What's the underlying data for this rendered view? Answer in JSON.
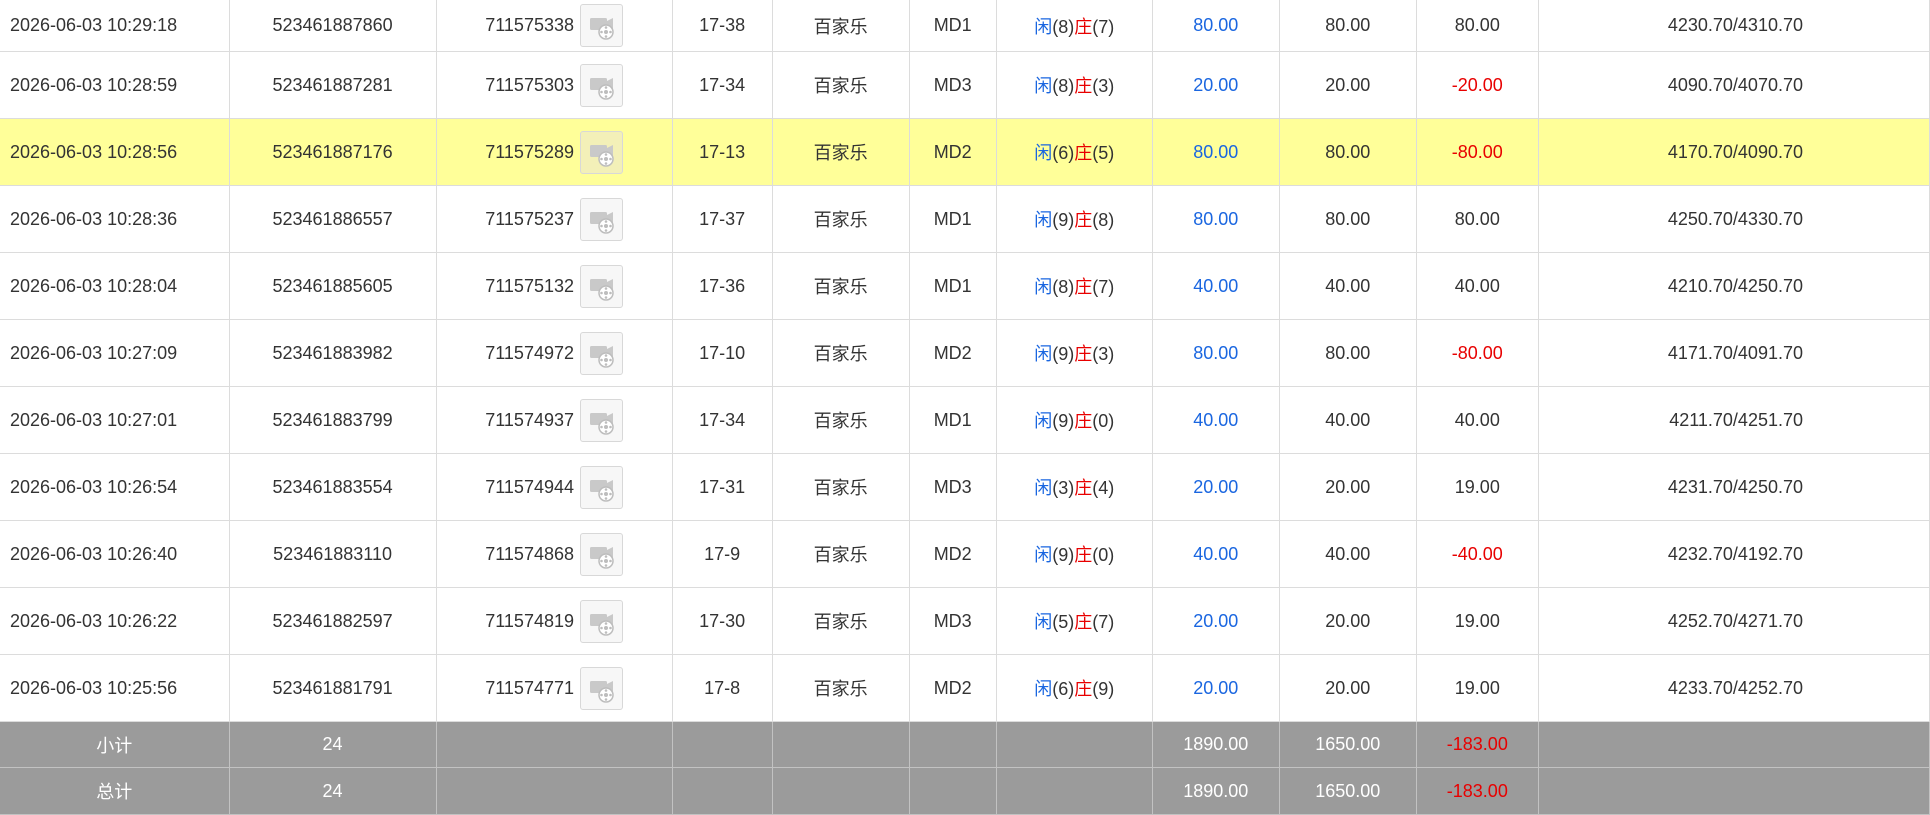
{
  "rows": [
    {
      "time": "2026-06-03 10:29:18",
      "order_id": "523461887860",
      "bet_id": "711575338",
      "table": "17-38",
      "game": "百家乐",
      "room": "MD1",
      "player_label": "闲",
      "player_score": "(8)",
      "banker_label": "庄",
      "banker_score": "(7)",
      "bet": "80.00",
      "valid": "80.00",
      "win": "80.00",
      "win_negative": false,
      "balance": "4230.70/4310.70",
      "highlighted": false
    },
    {
      "time": "2026-06-03 10:28:59",
      "order_id": "523461887281",
      "bet_id": "711575303",
      "table": "17-34",
      "game": "百家乐",
      "room": "MD3",
      "player_label": "闲",
      "player_score": "(8)",
      "banker_label": "庄",
      "banker_score": "(3)",
      "bet": "20.00",
      "valid": "20.00",
      "win": "-20.00",
      "win_negative": true,
      "balance": "4090.70/4070.70",
      "highlighted": false
    },
    {
      "time": "2026-06-03 10:28:56",
      "order_id": "523461887176",
      "bet_id": "711575289",
      "table": "17-13",
      "game": "百家乐",
      "room": "MD2",
      "player_label": "闲",
      "player_score": "(6)",
      "banker_label": "庄",
      "banker_score": "(5)",
      "bet": "80.00",
      "valid": "80.00",
      "win": "-80.00",
      "win_negative": true,
      "balance": "4170.70/4090.70",
      "highlighted": true
    },
    {
      "time": "2026-06-03 10:28:36",
      "order_id": "523461886557",
      "bet_id": "711575237",
      "table": "17-37",
      "game": "百家乐",
      "room": "MD1",
      "player_label": "闲",
      "player_score": "(9)",
      "banker_label": "庄",
      "banker_score": "(8)",
      "bet": "80.00",
      "valid": "80.00",
      "win": "80.00",
      "win_negative": false,
      "balance": "4250.70/4330.70",
      "highlighted": false
    },
    {
      "time": "2026-06-03 10:28:04",
      "order_id": "523461885605",
      "bet_id": "711575132",
      "table": "17-36",
      "game": "百家乐",
      "room": "MD1",
      "player_label": "闲",
      "player_score": "(8)",
      "banker_label": "庄",
      "banker_score": "(7)",
      "bet": "40.00",
      "valid": "40.00",
      "win": "40.00",
      "win_negative": false,
      "balance": "4210.70/4250.70",
      "highlighted": false
    },
    {
      "time": "2026-06-03 10:27:09",
      "order_id": "523461883982",
      "bet_id": "711574972",
      "table": "17-10",
      "game": "百家乐",
      "room": "MD2",
      "player_label": "闲",
      "player_score": "(9)",
      "banker_label": "庄",
      "banker_score": "(3)",
      "bet": "80.00",
      "valid": "80.00",
      "win": "-80.00",
      "win_negative": true,
      "balance": "4171.70/4091.70",
      "highlighted": false
    },
    {
      "time": "2026-06-03 10:27:01",
      "order_id": "523461883799",
      "bet_id": "711574937",
      "table": "17-34",
      "game": "百家乐",
      "room": "MD1",
      "player_label": "闲",
      "player_score": "(9)",
      "banker_label": "庄",
      "banker_score": "(0)",
      "bet": "40.00",
      "valid": "40.00",
      "win": "40.00",
      "win_negative": false,
      "balance": "4211.70/4251.70",
      "highlighted": false
    },
    {
      "time": "2026-06-03 10:26:54",
      "order_id": "523461883554",
      "bet_id": "711574944",
      "table": "17-31",
      "game": "百家乐",
      "room": "MD3",
      "player_label": "闲",
      "player_score": "(3)",
      "banker_label": "庄",
      "banker_score": "(4)",
      "bet": "20.00",
      "valid": "20.00",
      "win": "19.00",
      "win_negative": false,
      "balance": "4231.70/4250.70",
      "highlighted": false
    },
    {
      "time": "2026-06-03 10:26:40",
      "order_id": "523461883110",
      "bet_id": "711574868",
      "table": "17-9",
      "game": "百家乐",
      "room": "MD2",
      "player_label": "闲",
      "player_score": "(9)",
      "banker_label": "庄",
      "banker_score": "(0)",
      "bet": "40.00",
      "valid": "40.00",
      "win": "-40.00",
      "win_negative": true,
      "balance": "4232.70/4192.70",
      "highlighted": false
    },
    {
      "time": "2026-06-03 10:26:22",
      "order_id": "523461882597",
      "bet_id": "711574819",
      "table": "17-30",
      "game": "百家乐",
      "room": "MD3",
      "player_label": "闲",
      "player_score": "(5)",
      "banker_label": "庄",
      "banker_score": "(7)",
      "bet": "20.00",
      "valid": "20.00",
      "win": "19.00",
      "win_negative": false,
      "balance": "4252.70/4271.70",
      "highlighted": false
    },
    {
      "time": "2026-06-03 10:25:56",
      "order_id": "523461881791",
      "bet_id": "711574771",
      "table": "17-8",
      "game": "百家乐",
      "room": "MD2",
      "player_label": "闲",
      "player_score": "(6)",
      "banker_label": "庄",
      "banker_score": "(9)",
      "bet": "20.00",
      "valid": "20.00",
      "win": "19.00",
      "win_negative": false,
      "balance": "4233.70/4252.70",
      "highlighted": false
    }
  ],
  "subtotal": {
    "label": "小计",
    "count": "24",
    "bet": "1890.00",
    "valid": "1650.00",
    "win": "-183.00"
  },
  "total": {
    "label": "总计",
    "count": "24",
    "bet": "1890.00",
    "valid": "1650.00",
    "win": "-183.00"
  },
  "icons": {
    "replay": "video-replay-icon"
  },
  "colors": {
    "player": "#1a66e0",
    "banker": "#e80000",
    "negative": "#e80000",
    "highlight": "#ffff99",
    "summary_bg": "#9b9b9b"
  }
}
